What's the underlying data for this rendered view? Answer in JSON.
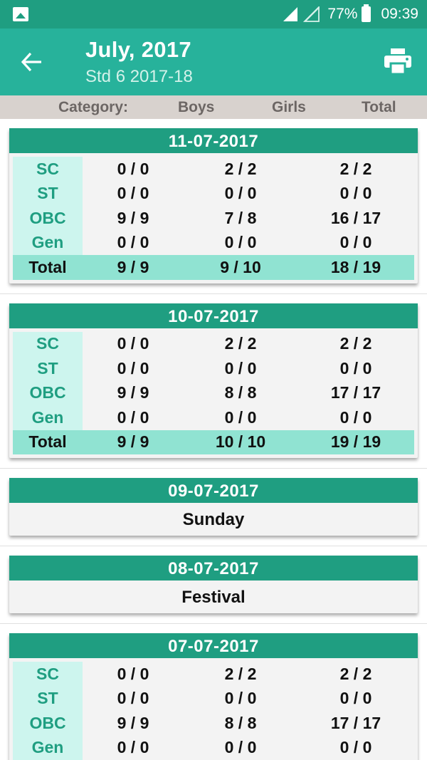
{
  "status": {
    "battery": "77%",
    "time": "09:39"
  },
  "header": {
    "title": "July, 2017",
    "subtitle": "Std 6 2017-18"
  },
  "columns": {
    "category": "Category:",
    "boys": "Boys",
    "girls": "Girls",
    "total": "Total"
  },
  "days": [
    {
      "date": "11-07-2017",
      "rows": [
        {
          "cat": "SC",
          "boys": "0 / 0",
          "girls": "2 / 2",
          "total": "2 / 2"
        },
        {
          "cat": "ST",
          "boys": "0 / 0",
          "girls": "0 / 0",
          "total": "0 / 0"
        },
        {
          "cat": "OBC",
          "boys": "9 / 9",
          "girls": "7 / 8",
          "total": "16 / 17"
        },
        {
          "cat": "Gen",
          "boys": "0 / 0",
          "girls": "0 / 0",
          "total": "0 / 0"
        },
        {
          "cat": "Total",
          "boys": "9 / 9",
          "girls": "9 / 10",
          "total": "18 / 19"
        }
      ]
    },
    {
      "date": "10-07-2017",
      "rows": [
        {
          "cat": "SC",
          "boys": "0 / 0",
          "girls": "2 / 2",
          "total": "2 / 2"
        },
        {
          "cat": "ST",
          "boys": "0 / 0",
          "girls": "0 / 0",
          "total": "0 / 0"
        },
        {
          "cat": "OBC",
          "boys": "9 / 9",
          "girls": "8 / 8",
          "total": "17 / 17"
        },
        {
          "cat": "Gen",
          "boys": "0 / 0",
          "girls": "0 / 0",
          "total": "0 / 0"
        },
        {
          "cat": "Total",
          "boys": "9 / 9",
          "girls": "10 / 10",
          "total": "19 / 19"
        }
      ]
    },
    {
      "date": "09-07-2017",
      "note": "Sunday"
    },
    {
      "date": "08-07-2017",
      "note": "Festival"
    },
    {
      "date": "07-07-2017",
      "rows": [
        {
          "cat": "SC",
          "boys": "0 / 0",
          "girls": "2 / 2",
          "total": "2 / 2"
        },
        {
          "cat": "ST",
          "boys": "0 / 0",
          "girls": "0 / 0",
          "total": "0 / 0"
        },
        {
          "cat": "OBC",
          "boys": "9 / 9",
          "girls": "8 / 8",
          "total": "17 / 17"
        },
        {
          "cat": "Gen",
          "boys": "0 / 0",
          "girls": "0 / 0",
          "total": "0 / 0"
        }
      ]
    }
  ]
}
